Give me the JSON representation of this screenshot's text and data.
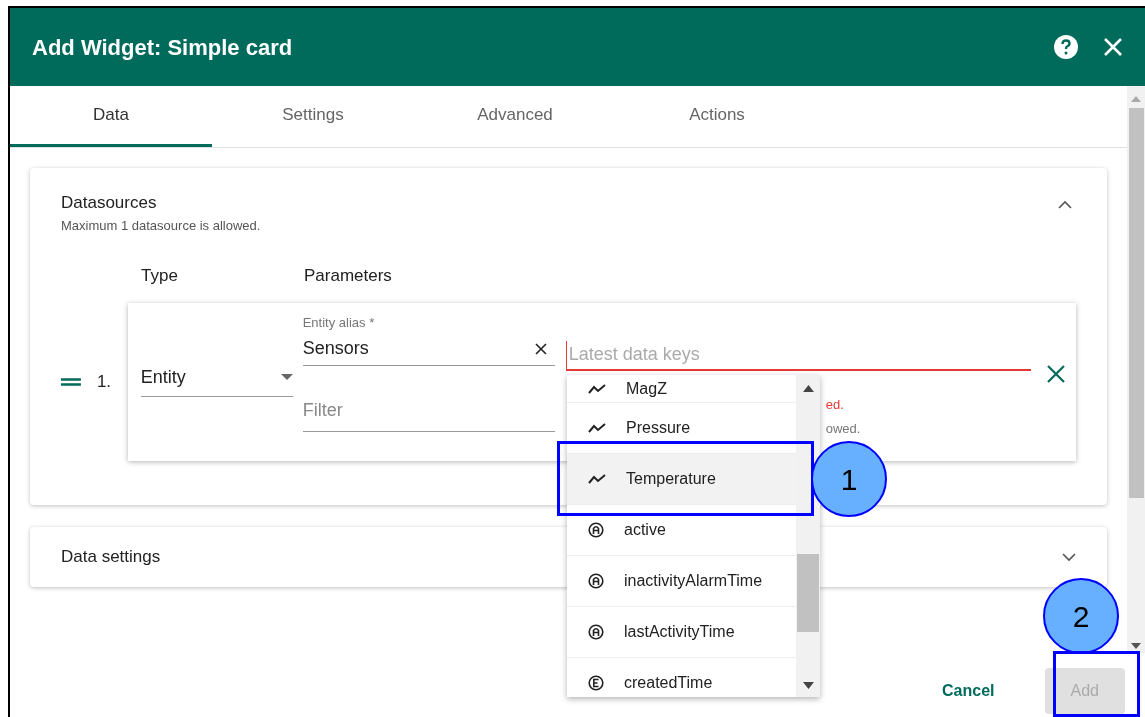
{
  "dialog": {
    "title": "Add Widget: Simple card"
  },
  "tabs": [
    {
      "label": "Data",
      "selected": true
    },
    {
      "label": "Settings",
      "selected": false
    },
    {
      "label": "Advanced",
      "selected": false
    },
    {
      "label": "Actions",
      "selected": false
    }
  ],
  "datasources": {
    "title": "Datasources",
    "subtitle": "Maximum 1 datasource is allowed.",
    "expanded": true,
    "column_headers": [
      "Type",
      "Parameters"
    ],
    "rows": [
      {
        "index": "1.",
        "type": "Entity",
        "entity_alias_label": "Entity alias *",
        "entity_alias": "Sensors",
        "filter_placeholder": "Filter",
        "data_keys_placeholder": "Latest data keys",
        "error_text": "ed.",
        "hint_text": "owed."
      }
    ]
  },
  "data_keys_dropdown": [
    {
      "kind": "timeseries",
      "label": "MagZ",
      "selected": false
    },
    {
      "kind": "timeseries",
      "label": "Pressure",
      "selected": false
    },
    {
      "kind": "timeseries",
      "label": "Temperature",
      "selected": true
    },
    {
      "kind": "attribute",
      "label": "active",
      "selected": false
    },
    {
      "kind": "attribute",
      "label": "inactivityAlarmTime",
      "selected": false
    },
    {
      "kind": "attribute",
      "label": "lastActivityTime",
      "selected": false
    },
    {
      "kind": "entity",
      "label": "createdTime",
      "selected": false
    }
  ],
  "data_settings": {
    "title": "Data settings",
    "expanded": false
  },
  "buttons": [
    {
      "label": "Cancel",
      "disabled": false
    },
    {
      "label": "Add",
      "disabled": true
    }
  ],
  "annotations": [
    "1",
    "2"
  ]
}
